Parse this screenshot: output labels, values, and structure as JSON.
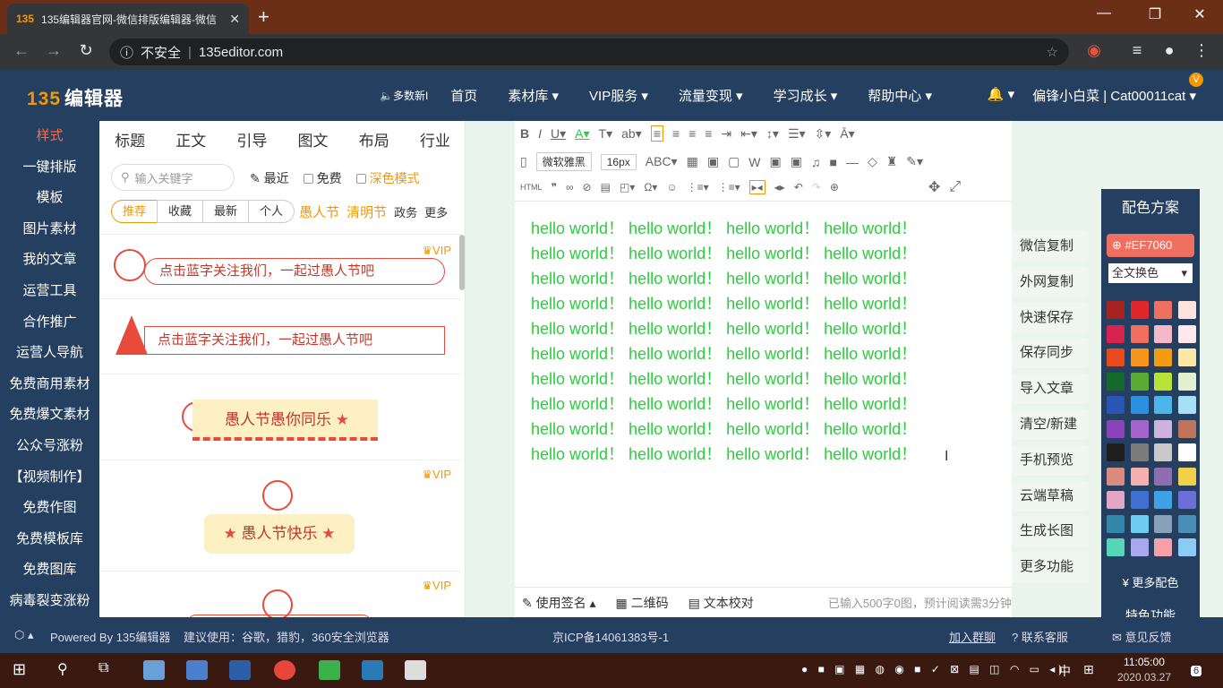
{
  "browser": {
    "tab_title": "135编辑器官网-微信排版编辑器-微信",
    "tab_favicon": "135",
    "insecure_label": "不安全",
    "url": "135editor.com"
  },
  "header": {
    "logo_num": "135",
    "logo_text": "编辑器",
    "speaker_text": "多数新I",
    "nav": [
      "首页",
      "素材库 ▾",
      "VIP服务 ▾",
      "流量变现 ▾",
      "学习成长 ▾",
      "帮助中心 ▾"
    ],
    "user": "偏锋小白菜 | Cat00011cat ▾",
    "vip_badge": "V"
  },
  "leftnav": [
    "样式",
    "一键排版",
    "模板",
    "图片素材",
    "我的文章",
    "运营工具",
    "合作推广",
    "运营人导航",
    "免费商用素材",
    "免费爆文素材",
    "公众号涨粉",
    "【视频制作】",
    "免费作图",
    "免费模板库",
    "免费图库",
    "病毒裂变涨粉"
  ],
  "stylepanel": {
    "categories": [
      "标题",
      "正文",
      "引导",
      "图文",
      "布局",
      "行业"
    ],
    "search_placeholder": "输入关键字",
    "filter_recent": "最近",
    "filter_free": "免费",
    "filter_dark": "深色模式",
    "subtabs": [
      "推荐",
      "收藏",
      "最新",
      "个人"
    ],
    "fest_tags": [
      "愚人节",
      "清明节"
    ],
    "plain_tags": [
      "政务",
      "更多"
    ],
    "vip_label": "VIP",
    "templates": [
      "点击蓝字关注我们，一起过愚人节吧",
      "点击蓝字关注我们，一起过愚人节吧",
      "愚人节愚你同乐",
      "愚人节快乐"
    ],
    "star": "★"
  },
  "editor": {
    "font_name": "微软雅黑",
    "font_size": "16px",
    "content_line": "hello world！ hello world！ hello world！ hello world！",
    "content_lines_count": 10,
    "footer_sign": "使用签名",
    "footer_qr": "二维码",
    "footer_proof": "文本校对",
    "footer_stat": "已输入500字0图，预计阅读需3分钟"
  },
  "actions": [
    "微信复制",
    "外网复制",
    "快速保存",
    "保存同步",
    "导入文章",
    "清空/新建",
    "手机预览",
    "云端草稿",
    "生成长图",
    "更多功能"
  ],
  "colorpanel": {
    "title": "配色方案",
    "hex": "#EF7060",
    "replace": "全文换色",
    "more": "更多配色",
    "special": "特色功能",
    "swatches": [
      "#a8231f",
      "#e0262a",
      "#ef7060",
      "#fde3dc",
      "#d6244f",
      "#ef7060",
      "#f4b8c8",
      "#fde8ee",
      "#e84a1c",
      "#f7941d",
      "#f39c12",
      "#fde8a6",
      "#16692b",
      "#5aab33",
      "#b7e238",
      "#e4efd0",
      "#2b55b4",
      "#2d8fe0",
      "#4cb6e8",
      "#a7dff6",
      "#8a43b8",
      "#a564cc",
      "#cdb3de",
      "#c0745a",
      "#1e1e1e",
      "#7b7b7b",
      "#c9c9c9",
      "#ffffff",
      "#d98b7f",
      "#f7b0b0",
      "#8e6db0",
      "#f0d049",
      "#e3a6c5",
      "#3f6fd1",
      "#3fa2e5",
      "#6b6fd8",
      "#3388aa",
      "#6ecbf3",
      "#88a0b8",
      "#4a8fb8",
      "#55d6b8",
      "#a8a8f0",
      "#f5a0a8",
      "#8ccbf3"
    ]
  },
  "footer": {
    "powered": "Powered By 135编辑器",
    "suggest": "建议使用：谷歌，猎豹，360安全浏览器",
    "icp": "京ICP备14061383号-1",
    "join": "加入群聊",
    "service": "联系客服",
    "feedback": "意见反馈"
  },
  "taskbar": {
    "time": "11:05:00",
    "date": "2020.03.27",
    "ime": "中",
    "notif_count": "6"
  }
}
